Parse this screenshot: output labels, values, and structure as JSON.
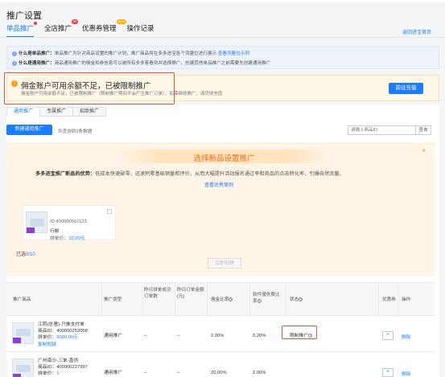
{
  "header": {
    "title": "推广设置",
    "tabs": [
      {
        "label": "单品推广",
        "marker": "dot"
      },
      {
        "label": "全店推广",
        "badge": "99"
      },
      {
        "label": "优惠券管理",
        "badge": "new"
      },
      {
        "label": "操作记录"
      }
    ],
    "back_link": "返回进宝首页"
  },
  "info": {
    "line1_prefix": "什么是单品推广：",
    "line1_text": "单品推广为针对商品设置的推广计划，推广商品将在多多进宝各个流量位进行展示",
    "line1_link": "查看流量位示例",
    "line2_prefix": "什么是通用推广：",
    "line2_text": "商品通用推广的佣金和券信息可以被所有多多客看到并选择推广，创建其他单品推广之前需要先创建通用推广"
  },
  "warning": {
    "title": "佣金账户可用余额不足，已被限制推广",
    "subtitle": "佣金账户可用余额不足，已被限制推广（限制推广期间不会产生推广订单），如需继续推广，请尽快充值",
    "button": "前往充值"
  },
  "subtabs": [
    "通用推广",
    "专属推广",
    "招商推广"
  ],
  "toolbar": {
    "new_button": "新建通用推广",
    "count_text": "共查询到2条数据",
    "search_placeholder": "请输入商品ID",
    "search_button": "查询"
  },
  "promo": {
    "title": "选择新品设置推广",
    "close": "×",
    "desc_bold": "多多进宝推广新品的优势：",
    "desc": "低成本快速破零，迅速积累基础销量和评价，从而大幅提升活动报名通过率和商品的点击转化率，引爆自然流量。",
    "link": "查看优秀案例",
    "card": {
      "id_text": "ID:400000561123",
      "name": "行邮",
      "price_label": "拼单价：",
      "price": "10.00元"
    },
    "selected_label": "已选",
    "selected_count": "0/10",
    "create_button": "立即创建"
  },
  "table": {
    "headers": [
      "推广商品",
      "推广类型",
      "昨日拼单成功订单数",
      "昨日订单金额(元)",
      "佣金比率",
      "软件服务费比率",
      "状态",
      "优惠券",
      "操作"
    ],
    "rows": [
      {
        "name": "江阴(总著)-只推支付单",
        "id_text": "商品ID：400000252058",
        "price_label": "拼单价：",
        "price": "5000.00元",
        "copy_link": "复制短链",
        "type": "通用推广",
        "orders": "–",
        "amount": "–",
        "commission": "2.00%",
        "service_fee": "0.20%",
        "status": "限制推广",
        "coupon_button": "+",
        "action": "删除"
      },
      {
        "name": "广州南沙-三单-直供",
        "id_text": "商品ID：400000227997",
        "price_label": "拼单价：",
        "price": "1",
        "type": "通用推广",
        "orders": "–",
        "amount": "–",
        "commission": "20.00%",
        "service_fee": "2.00%",
        "status": "",
        "coupon_button": "+",
        "action": "删除"
      }
    ]
  }
}
